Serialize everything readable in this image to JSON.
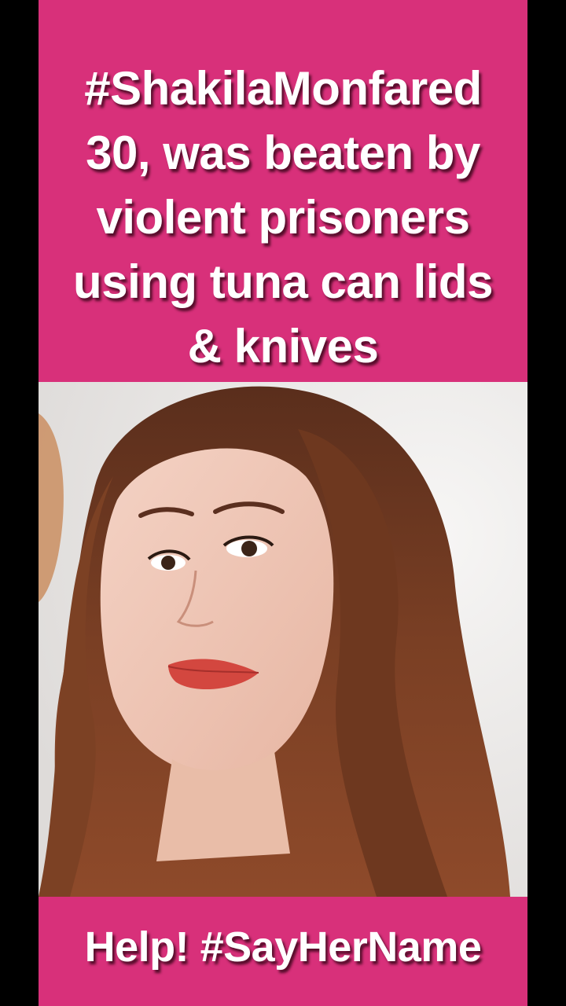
{
  "post": {
    "headline_lines": [
      "#ShakilaMonfared",
      "30, was beaten by",
      "violent prisoners",
      "using tuna can lids",
      "& knives"
    ],
    "footer": "Help! #SayHerName"
  },
  "colors": {
    "card_background": "#d8307a",
    "side_bars": "#000000",
    "text": "#ffffff"
  }
}
